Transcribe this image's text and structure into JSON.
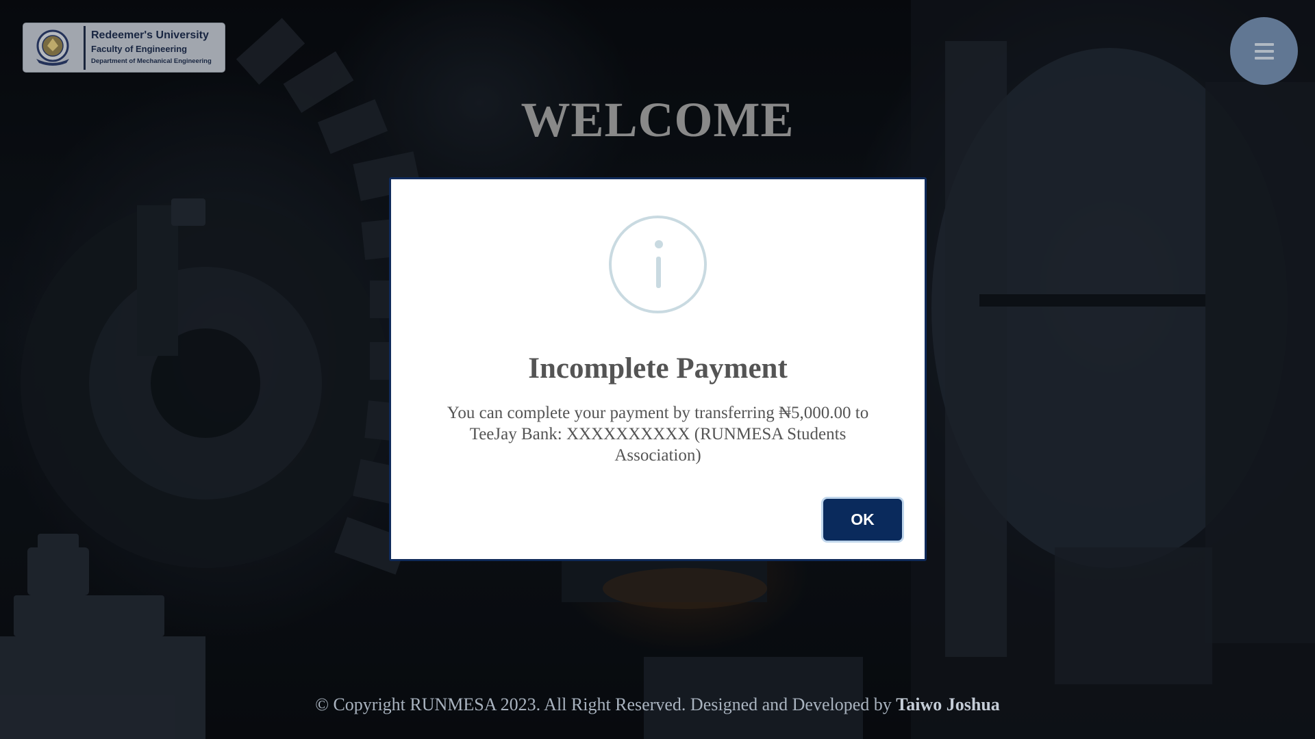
{
  "header": {
    "logo": {
      "university": "Redeemer's University",
      "faculty": "Faculty of Engineering",
      "department": "Department of Mechanical Engineering"
    },
    "menu_icon": "hamburger-menu-icon"
  },
  "hero": {
    "title": "WELCOME"
  },
  "modal": {
    "icon": "info-icon",
    "title": "Incomplete Payment",
    "message": "You can complete your payment by transferring ₦5,000.00 to TeeJay Bank: XXXXXXXXXX (RUNMESA Students Association)",
    "ok_label": "OK"
  },
  "footer": {
    "text": "© Copyright RUNMESA 2023. All Right Reserved. Designed and Developed by",
    "author": "Taiwo Joshua"
  },
  "colors": {
    "modal_border": "#0f2a5a",
    "ok_button": "#0a2a5c",
    "info_icon": "#c9dae1",
    "menu_button": "#6f88a8",
    "title_text": "#545454"
  }
}
